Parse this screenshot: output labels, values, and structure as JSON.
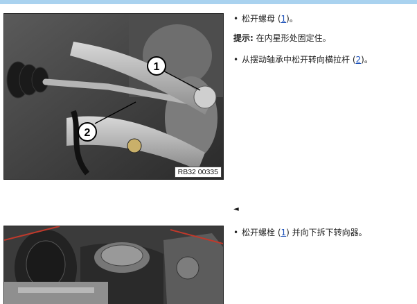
{
  "step1": {
    "image_tag": "RB32 00335",
    "callout_1": "1",
    "callout_2": "2",
    "line1_text": "松开螺母 (",
    "line1_ref": "1",
    "line1_end": ")。",
    "hint_label": "提示:",
    "hint_text": " 在内星形处固定住。",
    "line2_text": "从摆动轴承中松开转向横拉杆 (",
    "line2_ref": "2",
    "line2_end": ")。"
  },
  "marker": "◄",
  "step2": {
    "line1_text": "松开螺栓 (",
    "line1_ref": "1",
    "line1_end": ") 并向下拆下转向器。"
  },
  "bullet": "•"
}
